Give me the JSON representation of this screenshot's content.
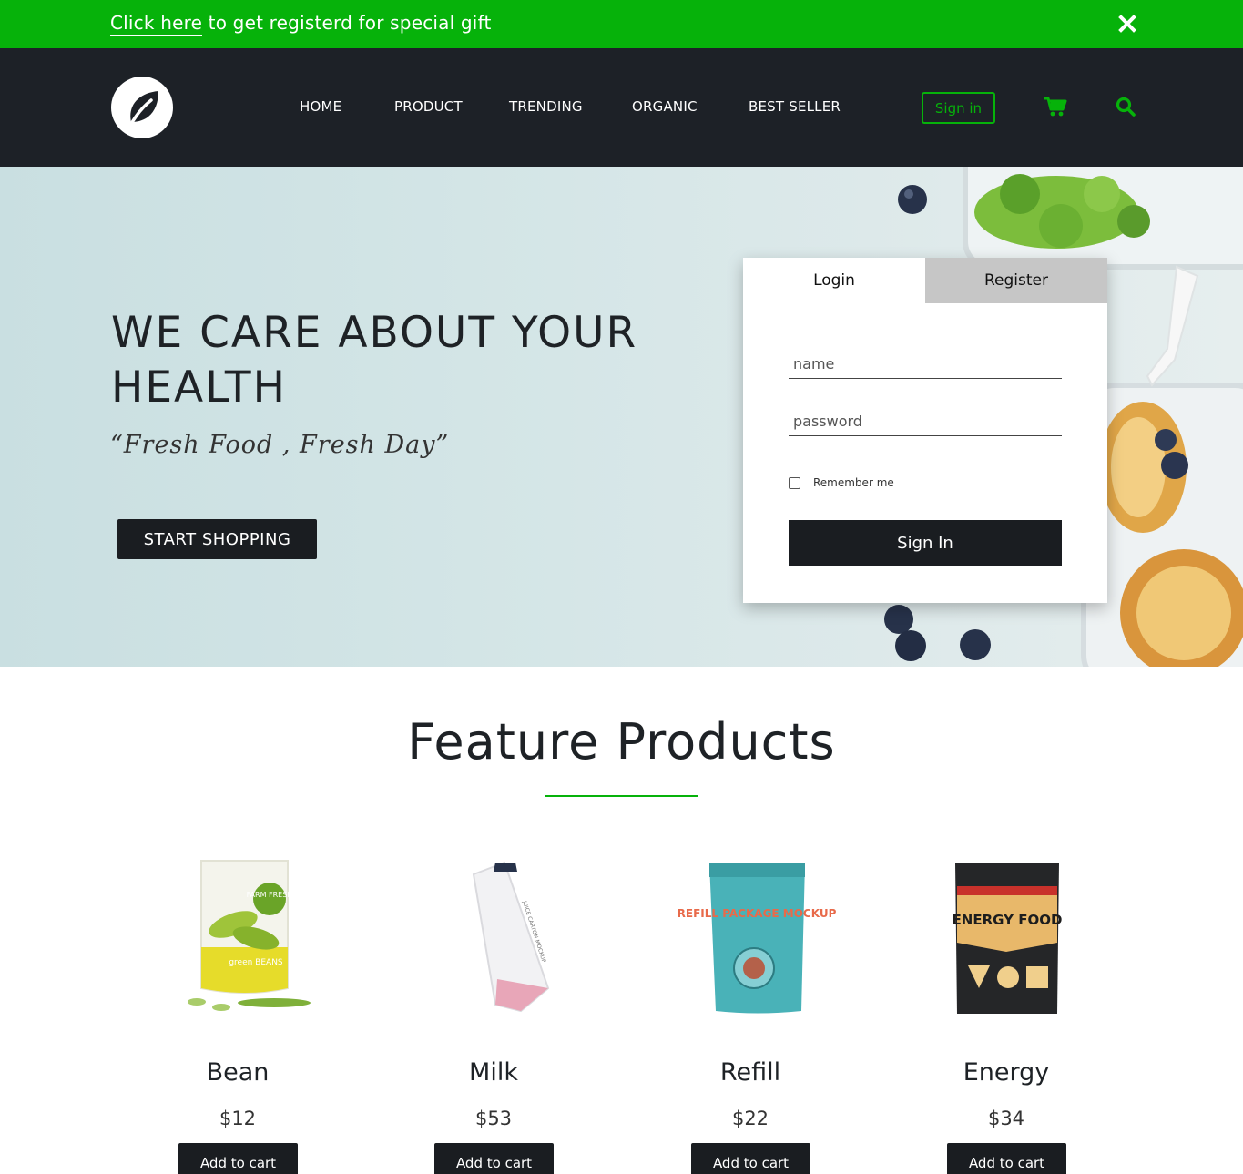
{
  "announcement": {
    "link_text": "Click here",
    "text": " to get registerd for special gift",
    "close_icon": "close-icon"
  },
  "nav": {
    "logo_icon": "leaf-icon",
    "links": [
      "HOME",
      "PRODUCT",
      "TRENDING",
      "ORGANIC",
      "BEST SELLER"
    ],
    "signin_label": "Sign in",
    "cart_icon": "cart-icon",
    "search_icon": "search-icon"
  },
  "hero": {
    "title": "WE CARE ABOUT YOUR HEALTH",
    "subtitle": "“Fresh Food , Fresh Day”",
    "cta_label": "START SHOPPING"
  },
  "auth": {
    "tabs": [
      "Login",
      "Register"
    ],
    "active_tab": "Login",
    "name_placeholder": "name",
    "password_placeholder": "password",
    "remember_label": "Remember me",
    "remember_checked": false,
    "submit_label": "Sign In"
  },
  "features": {
    "title": "Feature Products",
    "products": [
      {
        "name": "Bean",
        "price": "$12",
        "button": "Add to cart",
        "image": "green-beans-pouch"
      },
      {
        "name": "Milk",
        "price": "$53",
        "button": "Add to cart",
        "image": "juice-carton"
      },
      {
        "name": "Refill",
        "price": "$22",
        "button": "Add to cart",
        "image": "refill-package-pouch"
      },
      {
        "name": "Energy",
        "price": "$34",
        "button": "Add to cart",
        "image": "energy-food-bag"
      }
    ],
    "package_text": {
      "bean_brand": "FARM FRESH",
      "bean_product": "green BEANS",
      "milk_label": "JUICE CARTON MOCKUP",
      "refill_label": "REFILL PACKAGE MOCKUP",
      "energy_label": "ENERGY FOOD"
    }
  },
  "colors": {
    "accent_green": "#06b20a",
    "navbar_bg": "#1d2127",
    "button_dark": "#1a1d21",
    "register_tab_bg": "#c6c6c6"
  }
}
